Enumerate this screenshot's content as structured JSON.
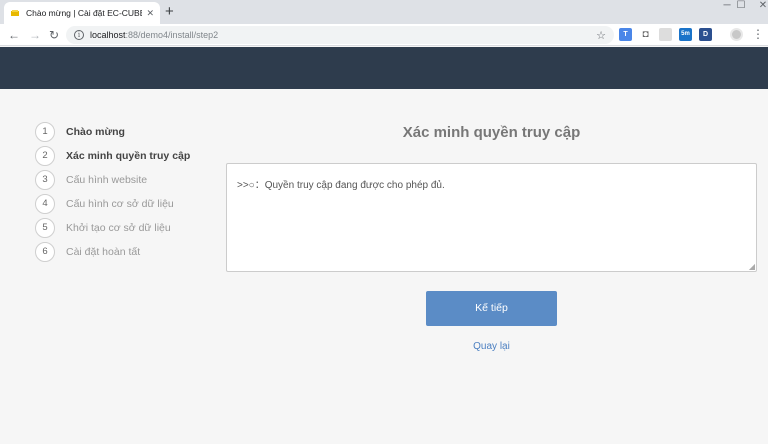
{
  "browser": {
    "tab_title": "Chào mừng | Cài đặt EC-CUBE",
    "tab_close": "✕",
    "new_tab": "+",
    "window_controls": {
      "minimize": "─",
      "maximize": "☐",
      "close": "✕"
    },
    "url_host": "localhost",
    "url_path": ":88/demo4/install/step2",
    "extensions": [
      {
        "name": "translate-extension-icon",
        "label": "T",
        "color": "#4a86e8"
      },
      {
        "name": "camera-extension-icon",
        "label": "◘",
        "color": "#888888"
      },
      {
        "name": "blank-extension-icon",
        "label": "",
        "color": "#dddddd"
      },
      {
        "name": "timer-extension-icon",
        "label": "5m",
        "color": "#1a73c9"
      },
      {
        "name": "d-extension-icon",
        "label": "D",
        "color": "#2b4f8f"
      }
    ]
  },
  "sidebar": {
    "steps": [
      {
        "num": "1",
        "label": "Chào mừng"
      },
      {
        "num": "2",
        "label": "Xác minh quyền truy cập"
      },
      {
        "num": "3",
        "label": "Cấu hình website"
      },
      {
        "num": "4",
        "label": "Cấu hình cơ sở dữ liệu"
      },
      {
        "num": "5",
        "label": "Khởi tạo cơ sở dữ liệu"
      },
      {
        "num": "6",
        "label": "Cài đặt hoàn tất"
      }
    ]
  },
  "main": {
    "title": "Xác minh quyền truy cập",
    "result_text": ">>○：Quyền truy cập đang được cho phép đủ.",
    "next_label": "Kế tiếp",
    "back_label": "Quay lại"
  }
}
